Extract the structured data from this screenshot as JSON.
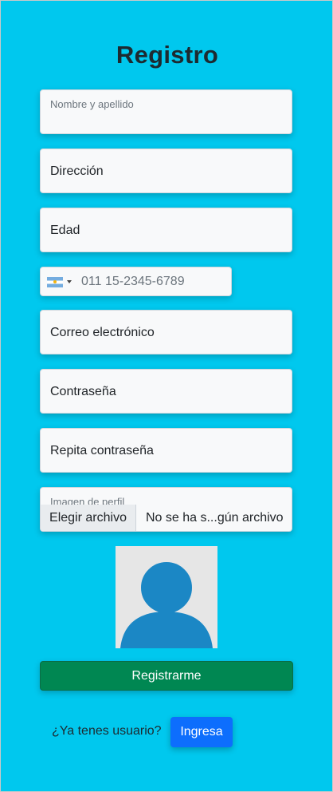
{
  "page": {
    "title": "Registro"
  },
  "form": {
    "full_name": {
      "label": "Nombre y apellido",
      "value": ""
    },
    "address": {
      "placeholder": "Dirección"
    },
    "age": {
      "placeholder": "Edad"
    },
    "phone": {
      "placeholder": "011 15-2345-6789",
      "country_flag": "argentina-flag-icon"
    },
    "email": {
      "placeholder": "Correo electrónico"
    },
    "password": {
      "placeholder": "Contraseña"
    },
    "password_repeat": {
      "placeholder": "Repita contraseña"
    },
    "profile_image": {
      "label": "Imagen de perfil",
      "button_label": "Elegir archivo",
      "status": "No se ha s...gún archivo"
    },
    "avatar_icon": "default-user-avatar-icon",
    "submit_label": "Registrarme"
  },
  "login": {
    "question": "¿Ya tenes usuario?",
    "button_label": "Ingresa"
  },
  "colors": {
    "background": "#00c8ee",
    "submit": "#008752",
    "login_button": "#0d6efd",
    "avatar": "#1b87c5"
  }
}
